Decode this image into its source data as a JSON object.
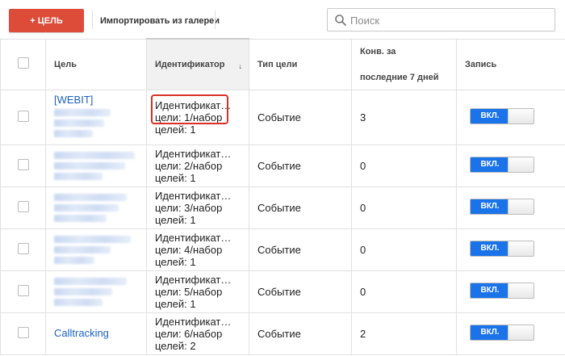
{
  "toolbar": {
    "new_goal_label": "+ ЦЕЛЬ",
    "import_label": "Импортировать из галереи",
    "search_placeholder": "Поиск",
    "accent_color": "#dd4b39"
  },
  "table": {
    "headers": {
      "goal": "Цель",
      "identifier": "Идентификатор",
      "sort_indicator": "↓",
      "goal_type": "Тип цели",
      "conversions_line1": "Конв. за",
      "conversions_line2": "последние 7 дней",
      "recording": "Запись"
    },
    "rows": [
      {
        "goal_name": "[WEBIT]",
        "identifier": "Идентификат…\nцели: 1/набор\nцелей: 1",
        "type": "Событие",
        "conversions": "3",
        "recording": "ВКЛ."
      },
      {
        "goal_name": "",
        "identifier": "Идентификат…\nцели: 2/набор\nцелей: 1",
        "type": "Событие",
        "conversions": "0",
        "recording": "ВКЛ."
      },
      {
        "goal_name": "",
        "identifier": "Идентификат…\nцели: 3/набор\nцелей: 1",
        "type": "Событие",
        "conversions": "0",
        "recording": "ВКЛ."
      },
      {
        "goal_name": "",
        "identifier": "Идентификат…\nцели: 4/набор\nцелей: 1",
        "type": "Событие",
        "conversions": "0",
        "recording": "ВКЛ."
      },
      {
        "goal_name": "",
        "identifier": "Идентификат…\nцели: 5/набор\nцелей: 1",
        "type": "Событие",
        "conversions": "0",
        "recording": "ВКЛ."
      },
      {
        "goal_name": "Calltracking",
        "identifier": "Идентификат…\nцели: 6/набор\nцелей: 2",
        "type": "Событие",
        "conversions": "2",
        "recording": "ВКЛ."
      }
    ]
  },
  "colors": {
    "toggle_on": "#1a73e8",
    "link": "#1a62c6",
    "highlight_box": "#d93025"
  }
}
